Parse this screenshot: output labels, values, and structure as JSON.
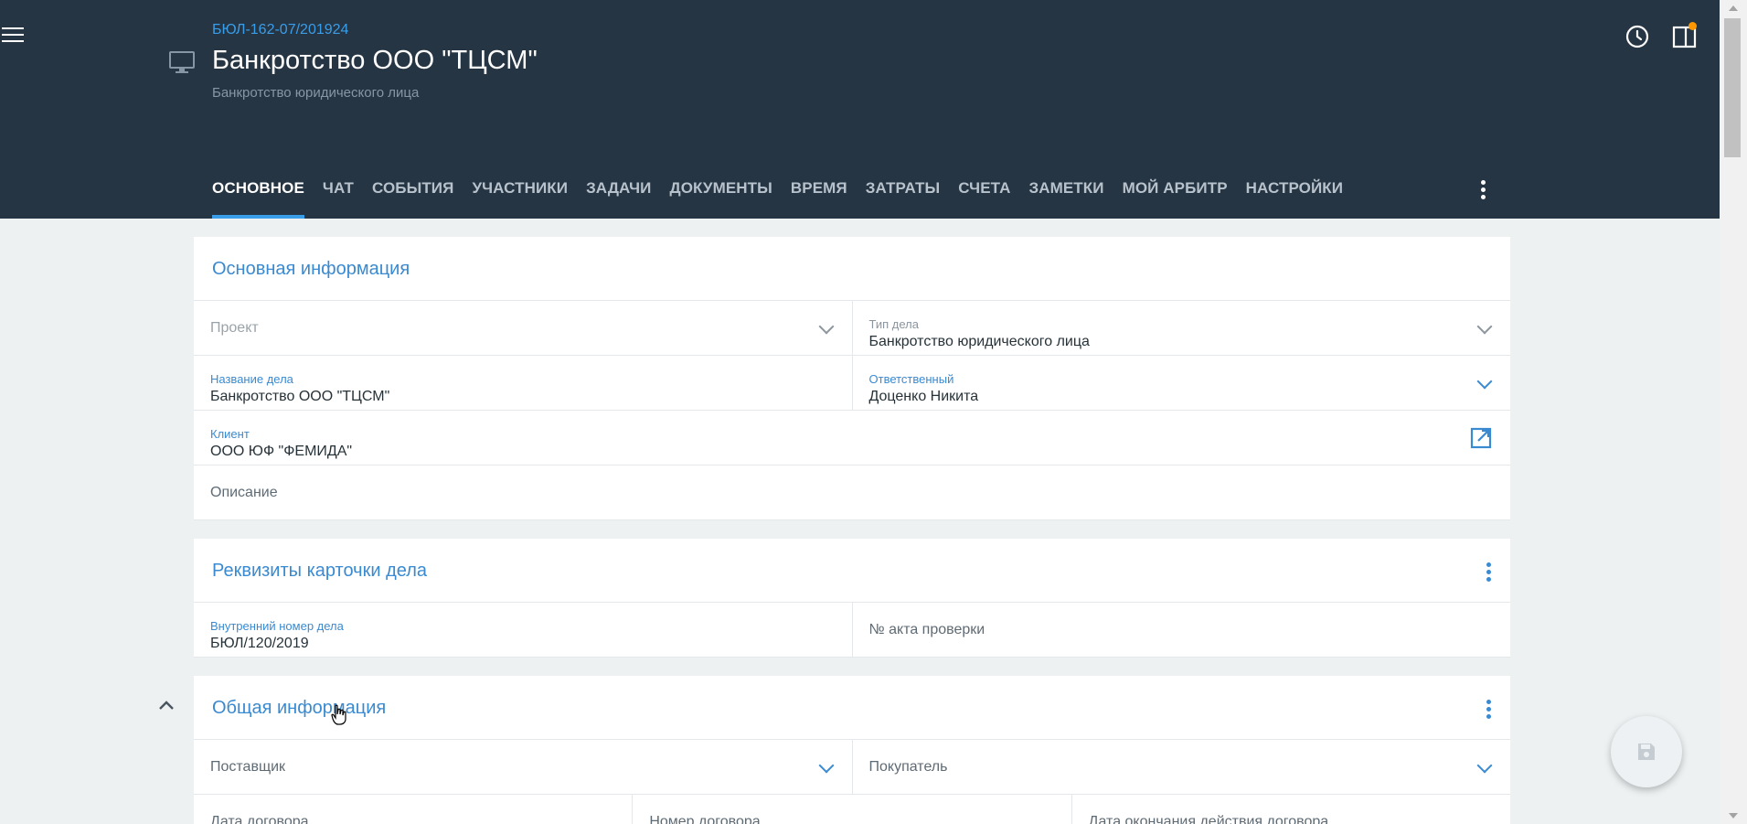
{
  "header": {
    "case_number": "БЮЛ-162-07/201924",
    "title": "Банкротство ООО \"ТЦСМ\"",
    "subtitle": "Банкротство юридического лица",
    "background_color": "#263543",
    "accent_color": "#3a9de8",
    "icons": [
      "menu-icon",
      "monitor-icon",
      "clock-icon",
      "panel-icon"
    ]
  },
  "tabs": [
    {
      "label": "ОСНОВНОЕ",
      "active": true
    },
    {
      "label": "ЧАТ"
    },
    {
      "label": "СОБЫТИЯ"
    },
    {
      "label": "УЧАСТНИКИ"
    },
    {
      "label": "ЗАДАЧИ"
    },
    {
      "label": "ДОКУМЕНТЫ"
    },
    {
      "label": "ВРЕМЯ"
    },
    {
      "label": "ЗАТРАТЫ"
    },
    {
      "label": "СЧЕТА"
    },
    {
      "label": "ЗАМЕТКИ"
    },
    {
      "label": "МОЙ АРБИТР"
    },
    {
      "label": "НАСТРОЙКИ"
    }
  ],
  "main_info": {
    "title": "Основная информация",
    "project_placeholder": "Проект",
    "case_type_label": "Тип дела",
    "case_type_value": "Банкротство юридического лица",
    "case_name_label": "Название дела",
    "case_name_value": "Банкротство ООО \"ТЦСМ\"",
    "responsible_label": "Ответственный",
    "responsible_value": "Доценко Никита",
    "client_label": "Клиент",
    "client_value": "ООО ЮФ \"ФЕМИДА\"",
    "description_placeholder": "Описание"
  },
  "requisites": {
    "title": "Реквизиты карточки дела",
    "internal_number_label": "Внутренний номер дела",
    "internal_number_value": "БЮЛ/120/2019",
    "act_number_placeholder": "№ акта проверки"
  },
  "general_info": {
    "title": "Общая информация",
    "supplier_placeholder": "Поставщик",
    "buyer_placeholder": "Покупатель",
    "contract_date_placeholder": "Дата договора",
    "contract_number_placeholder": "Номер договора",
    "contract_end_placeholder": "Дата окончания действия договора"
  }
}
